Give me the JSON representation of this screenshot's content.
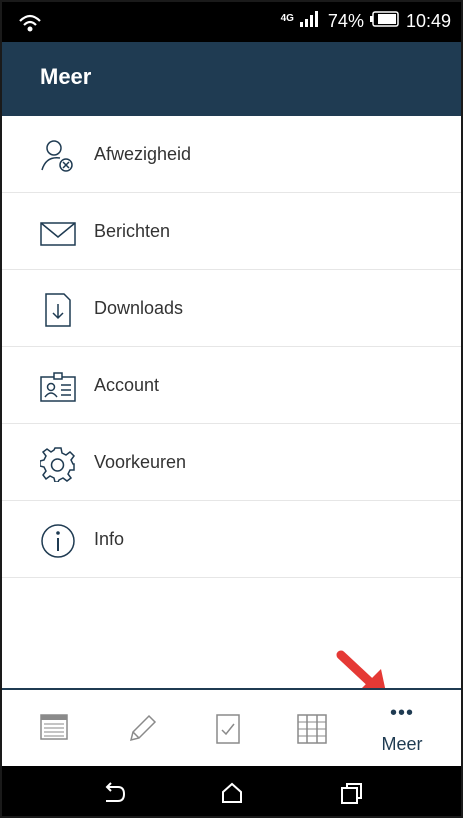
{
  "status_bar": {
    "network": "4G",
    "battery": "74%",
    "time": "10:49"
  },
  "header": {
    "title": "Meer"
  },
  "menu": {
    "items": [
      {
        "label": "Afwezigheid",
        "icon": "person-x-icon"
      },
      {
        "label": "Berichten",
        "icon": "envelope-icon"
      },
      {
        "label": "Downloads",
        "icon": "download-icon"
      },
      {
        "label": "Account",
        "icon": "id-card-icon"
      },
      {
        "label": "Voorkeuren",
        "icon": "gear-icon"
      },
      {
        "label": "Info",
        "icon": "info-icon"
      }
    ]
  },
  "tabs": {
    "more_dots": "•••",
    "more_label": "Meer",
    "icons": [
      "calendar-icon",
      "pencil-icon",
      "checklist-icon",
      "grid-icon",
      "more-icon"
    ]
  },
  "colors": {
    "header_bg": "#1f3b52",
    "arrow": "#e53935"
  }
}
